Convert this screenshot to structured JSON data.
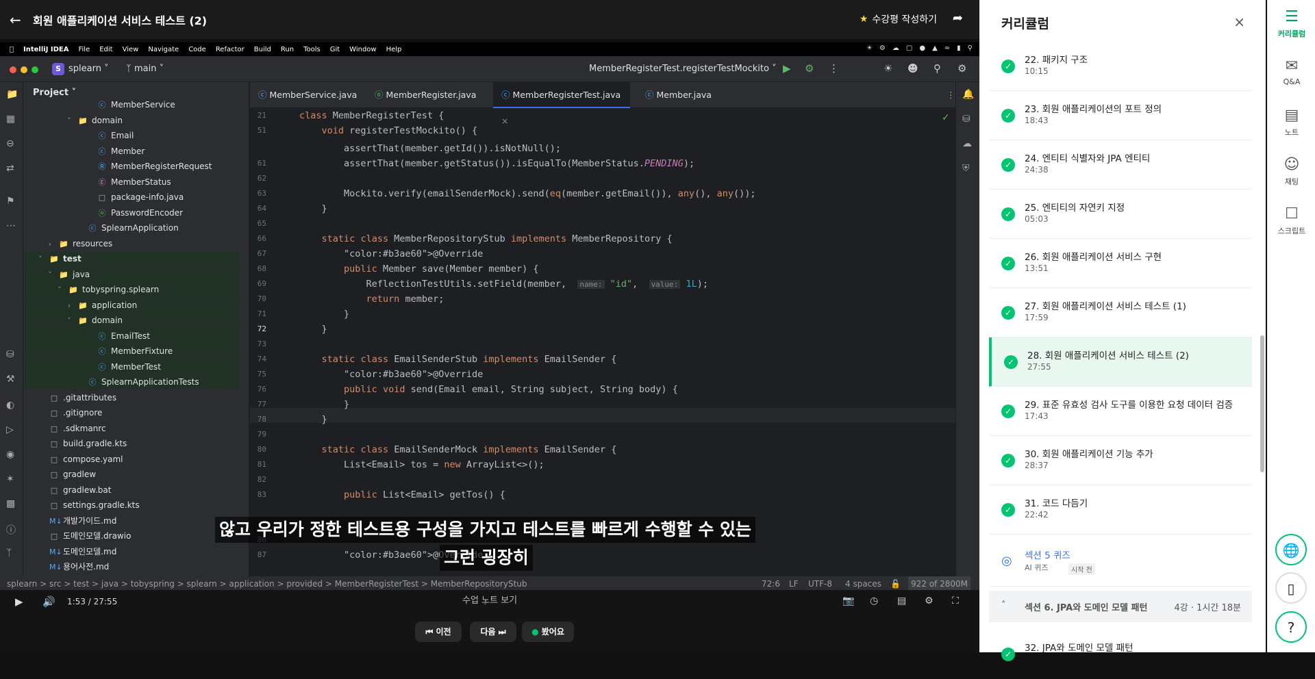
{
  "lecture": {
    "title": "회원 애플리케이션 서비스 테스트 (2)",
    "review_label": "수강평 작성하기"
  },
  "mac_menu": [
    "IntelliJ IDEA",
    "File",
    "Edit",
    "View",
    "Navigate",
    "Code",
    "Refactor",
    "Build",
    "Run",
    "Tools",
    "Git",
    "Window",
    "Help"
  ],
  "ide": {
    "project_badge": "S",
    "project": "splearn",
    "branch": "main",
    "run_config": "MemberRegisterTest.registerTestMockito"
  },
  "project_panel": {
    "header": "Project",
    "items": [
      {
        "label": "MemberService",
        "depth": 7,
        "icon": "C"
      },
      {
        "label": "domain",
        "depth": 5,
        "icon": "folder",
        "arrow": "v"
      },
      {
        "label": "Email",
        "depth": 7,
        "icon": "C"
      },
      {
        "label": "Member",
        "depth": 7,
        "icon": "C"
      },
      {
        "label": "MemberRegisterRequest",
        "depth": 7,
        "icon": "R"
      },
      {
        "label": "MemberStatus",
        "depth": 7,
        "icon": "E"
      },
      {
        "label": "package-info.java",
        "depth": 7,
        "icon": "file"
      },
      {
        "label": "PasswordEncoder",
        "depth": 7,
        "icon": "I"
      },
      {
        "label": "SplearnApplication",
        "depth": 6,
        "icon": "C"
      },
      {
        "label": "resources",
        "depth": 3,
        "icon": "folder",
        "arrow": ">"
      },
      {
        "label": "test",
        "depth": 2,
        "icon": "folder",
        "arrow": "v",
        "green": true
      },
      {
        "label": "java",
        "depth": 3,
        "icon": "folder",
        "arrow": "v",
        "green": true
      },
      {
        "label": "tobyspring.splearn",
        "depth": 4,
        "icon": "folder",
        "arrow": "v",
        "green": true
      },
      {
        "label": "application",
        "depth": 5,
        "icon": "folder",
        "arrow": ">",
        "green": true
      },
      {
        "label": "domain",
        "depth": 5,
        "icon": "folder",
        "arrow": "v",
        "green": true
      },
      {
        "label": "EmailTest",
        "depth": 7,
        "icon": "C",
        "green": true
      },
      {
        "label": "MemberFixture",
        "depth": 7,
        "icon": "C",
        "green": true
      },
      {
        "label": "MemberTest",
        "depth": 7,
        "icon": "C",
        "green": true
      },
      {
        "label": "SplearnApplicationTests",
        "depth": 6,
        "icon": "C",
        "green": true
      },
      {
        "label": ".gitattributes",
        "depth": 2,
        "icon": "file"
      },
      {
        "label": ".gitignore",
        "depth": 2,
        "icon": "file"
      },
      {
        "label": ".sdkmanrc",
        "depth": 2,
        "icon": "file"
      },
      {
        "label": "build.gradle.kts",
        "depth": 2,
        "icon": "file"
      },
      {
        "label": "compose.yaml",
        "depth": 2,
        "icon": "file"
      },
      {
        "label": "gradlew",
        "depth": 2,
        "icon": "file"
      },
      {
        "label": "gradlew.bat",
        "depth": 2,
        "icon": "file"
      },
      {
        "label": "settings.gradle.kts",
        "depth": 2,
        "icon": "file"
      },
      {
        "label": "개발가이드.md",
        "depth": 2,
        "icon": "md"
      },
      {
        "label": "도메인모델.drawio",
        "depth": 2,
        "icon": "file"
      },
      {
        "label": "도메인모델.md",
        "depth": 2,
        "icon": "md"
      },
      {
        "label": "용어사전.md",
        "depth": 2,
        "icon": "md"
      }
    ]
  },
  "tabs": [
    "MemberService.java",
    "MemberRegister.java",
    "MemberRegisterTest.java",
    "Member.java"
  ],
  "code_lines": [
    {
      "n": "21",
      "t": "class MemberRegisterTest {"
    },
    {
      "n": "51",
      "t": "    void registerTestMockito() {"
    },
    {
      "n": "",
      "t": "        assertThat(member.getId()).isNotNull();"
    },
    {
      "n": "61",
      "t": "        assertThat(member.getStatus()).isEqualTo(MemberStatus.PENDING);"
    },
    {
      "n": "62",
      "t": ""
    },
    {
      "n": "63",
      "t": "        Mockito.verify(emailSenderMock).send(eq(member.getEmail()), any(), any());"
    },
    {
      "n": "64",
      "t": "    }"
    },
    {
      "n": "65",
      "t": ""
    },
    {
      "n": "66",
      "t": "    static class MemberRepositoryStub implements MemberRepository {"
    },
    {
      "n": "67",
      "t": "        @Override"
    },
    {
      "n": "68",
      "t": "        public Member save(Member member) {"
    },
    {
      "n": "69",
      "t": "            ReflectionTestUtils.setField(member,  name: \"id\",  value: 1L);"
    },
    {
      "n": "70",
      "t": "            return member;"
    },
    {
      "n": "71",
      "t": "        }"
    },
    {
      "n": "72",
      "t": "    }"
    },
    {
      "n": "73",
      "t": ""
    },
    {
      "n": "74",
      "t": "    static class EmailSenderStub implements EmailSender {"
    },
    {
      "n": "75",
      "t": "        @Override"
    },
    {
      "n": "76",
      "t": "        public void send(Email email, String subject, String body) {"
    },
    {
      "n": "77",
      "t": "        }"
    },
    {
      "n": "78",
      "t": "    }"
    },
    {
      "n": "79",
      "t": ""
    },
    {
      "n": "80",
      "t": "    static class EmailSenderMock implements EmailSender {"
    },
    {
      "n": "81",
      "t": "        List<Email> tos = new ArrayList<>();"
    },
    {
      "n": "82",
      "t": ""
    },
    {
      "n": "83",
      "t": "        public List<Email> getTos() {"
    },
    {
      "n": "",
      "t": ""
    },
    {
      "n": "",
      "t": ""
    },
    {
      "n": "86",
      "t": ""
    },
    {
      "n": "87",
      "t": "        @Override"
    }
  ],
  "statusbar": {
    "path": "splearn  >  src  >  test  >  java  >  tobyspring  >  splearn  >  application  >  provided  >  MemberRegisterTest  >  MemberRepositoryStub",
    "pos": "72:6",
    "le": "LF",
    "enc": "UTF-8",
    "indent": "4 spaces",
    "mem": "922 of 2800M"
  },
  "subtitles": {
    "line1": "않고 우리가 정한 테스트용 구성을 가지고 테스트를 빠르게 수행할 수 있는",
    "line2": "그런 굉장히"
  },
  "player": {
    "time": "1:53 / 27:55",
    "notes_label": "수업 노트 보기",
    "prev": "이전",
    "next": "다음",
    "done": "봤어요"
  },
  "curriculum": {
    "header": "커리큘럼",
    "items": [
      {
        "title": "22. 패키지 구조",
        "dur": "10:15"
      },
      {
        "title": "23. 회원 애플리케이션의 포트 정의",
        "dur": "18:43"
      },
      {
        "title": "24. 엔티티 식별자와 JPA 엔티티",
        "dur": "24:38"
      },
      {
        "title": "25. 엔티티의 자연키 지정",
        "dur": "05:03"
      },
      {
        "title": "26. 회원 애플리케이션 서비스 구현",
        "dur": "13:51"
      },
      {
        "title": "27. 회원 애플리케이션 서비스 테스트 (1)",
        "dur": "17:59"
      },
      {
        "title": "28. 회원 애플리케이션 서비스 테스트 (2)",
        "dur": "27:55",
        "active": true
      },
      {
        "title": "29. 표준 유효성 검사 도구를 이용한 요청 데이터 검증",
        "dur": "17:43"
      },
      {
        "title": "30. 회원 애플리케이션 기능 추가",
        "dur": "28:37"
      },
      {
        "title": "31. 코드 다듬기",
        "dur": "22:42"
      }
    ],
    "quiz": {
      "title": "섹션 5 퀴즈",
      "tag": "AI 퀴즈",
      "status": "시작 전"
    },
    "section": {
      "title": "섹션 6. JPA와 도메인 모델 패턴",
      "meta": "4강 · 1시간 18분"
    },
    "next_item": "32. JPA와 도메인 모델 패턴"
  },
  "rail": [
    {
      "label": "커리큘럼",
      "icon": "list-icon"
    },
    {
      "label": "Q&A",
      "icon": "chat-icon"
    },
    {
      "label": "노트",
      "icon": "note-icon"
    },
    {
      "label": "채팅",
      "icon": "smile-icon"
    },
    {
      "label": "스크립트",
      "icon": "cc-icon"
    }
  ],
  "colors": {
    "accent": "#00c471",
    "ide_bg": "#1e1f22",
    "tab_active": "#3574f0"
  }
}
